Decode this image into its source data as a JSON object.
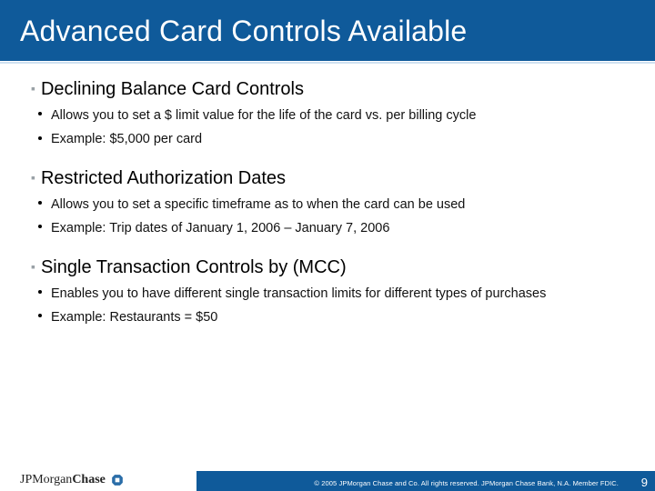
{
  "title": "Advanced Card Controls Available",
  "sections": [
    {
      "heading": "Declining Balance Card Controls",
      "bullets": [
        "Allows you to set a $ limit value for the life of the card vs. per billing cycle",
        "Example: $5,000 per card"
      ]
    },
    {
      "heading": "Restricted Authorization Dates",
      "bullets": [
        "Allows you to set a specific timeframe as to when the card can be used",
        "Example: Trip dates of January 1, 2006 – January 7, 2006"
      ]
    },
    {
      "heading": "Single Transaction Controls by (MCC)",
      "bullets": [
        "Enables you to have different single transaction limits for different types of purchases",
        "Example:  Restaurants = $50"
      ]
    }
  ],
  "footer": {
    "brand_jp": "JPMorgan",
    "brand_chase": "Chase",
    "copyright": "© 2005 JPMorgan Chase and Co. All rights reserved. JPMorgan Chase Bank, N.A. Member FDIC.",
    "page_number": "9"
  }
}
